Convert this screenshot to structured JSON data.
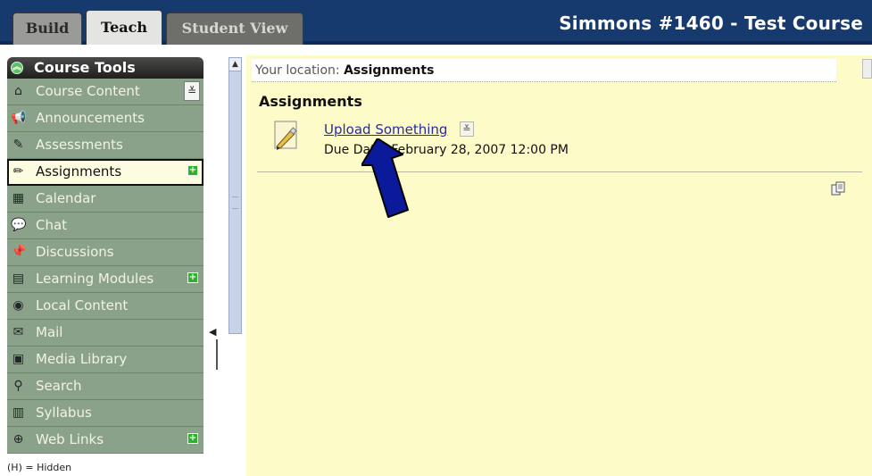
{
  "tabs": [
    {
      "label": "Build"
    },
    {
      "label": "Teach"
    },
    {
      "label": "Student View"
    }
  ],
  "course_title": "Simmons #1460 - Test Course",
  "sidebar": {
    "header": "Course Tools",
    "items": [
      {
        "label": "Course Content",
        "icon": "home-icon"
      },
      {
        "label": "Announcements",
        "icon": "megaphone-icon"
      },
      {
        "label": "Assessments",
        "icon": "quiz-icon"
      },
      {
        "label": "Assignments",
        "icon": "pencil-page-icon"
      },
      {
        "label": "Calendar",
        "icon": "calendar-icon"
      },
      {
        "label": "Chat",
        "icon": "chat-icon"
      },
      {
        "label": "Discussions",
        "icon": "pushpin-icon"
      },
      {
        "label": "Learning Modules",
        "icon": "module-icon"
      },
      {
        "label": "Local Content",
        "icon": "cd-icon"
      },
      {
        "label": "Mail",
        "icon": "envelope-icon"
      },
      {
        "label": "Media Library",
        "icon": "media-icon"
      },
      {
        "label": "Search",
        "icon": "magnifier-icon"
      },
      {
        "label": "Syllabus",
        "icon": "syllabus-icon"
      },
      {
        "label": "Web Links",
        "icon": "globe-icon"
      }
    ],
    "hidden_note": "(H) = Hidden"
  },
  "breadcrumb": {
    "prefix": "Your location:",
    "current": "Assignments"
  },
  "main": {
    "title": "Assignments",
    "assignment": {
      "name": "Upload Something",
      "due": "Due Date: February 28, 2007 12:00 PM"
    }
  },
  "colors": {
    "banner": "#163a6e",
    "sidebar_item": "#8aa18a",
    "content_bg": "#fdfbc8",
    "link": "#2a2aa8",
    "arrow": "#0a1a9a"
  }
}
